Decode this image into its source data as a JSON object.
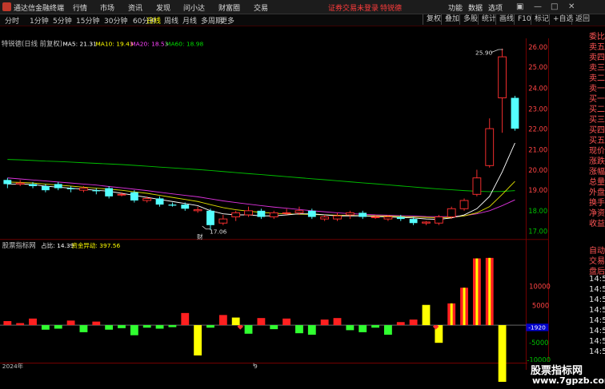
{
  "app": {
    "name": "通达信金融终端"
  },
  "menu": [
    "行情",
    "市场",
    "资讯",
    "发现",
    "问小达",
    "财富圈",
    "交易"
  ],
  "warning": "证券交易未登录",
  "stock_tag": "特锐德",
  "right_menu": [
    "功能",
    "数据",
    "选项"
  ],
  "login": "游客",
  "periods": [
    "分时",
    "1分钟",
    "5分钟",
    "15分钟",
    "30分钟",
    "60分钟",
    "日线",
    "周线",
    "月线",
    "多周期",
    "更多"
  ],
  "active_period": "日线",
  "tool_buttons": [
    "复权",
    "叠加",
    "多股",
    "统计",
    "画线",
    "F10",
    "标记",
    "+自选",
    "返回"
  ],
  "main_title": "特锐德(日线 前复权)",
  "ma": [
    {
      "label": "MA5: 21.31",
      "color": "#ffffff"
    },
    {
      "label": "MA10: 19.43",
      "color": "#ffff00"
    },
    {
      "label": "MA20: 18.53",
      "color": "#ff44ff"
    },
    {
      "label": "MA60: 18.98",
      "color": "#00dd00"
    }
  ],
  "sub_title": "股票指标网",
  "sub_values": [
    {
      "label": "占比: 14.39",
      "color": "#ffffff"
    },
    {
      "label": "资金异动: 397.56",
      "color": "#ffff00"
    }
  ],
  "price_axis": [
    "26.00",
    "25.00",
    "24.00",
    "23.00",
    "22.00",
    "21.00",
    "20.00",
    "19.00",
    "18.00",
    "17.00"
  ],
  "sub_axis": [
    "10000",
    "5000",
    "-5000",
    "-10000"
  ],
  "sub_current": "-1920",
  "annotations": {
    "high": "25.90",
    "low": "17.06",
    "marker": "财"
  },
  "date_labels": [
    "2024年",
    "9"
  ],
  "right_panel": [
    "委比",
    "卖五",
    "卖四",
    "卖三",
    "卖二",
    "卖一",
    "买一",
    "买二",
    "买三",
    "买四",
    "买五",
    "现价",
    "涨跌",
    "涨幅",
    "总量",
    "外盘",
    "换手",
    "净资",
    "收益",
    "自动",
    "交易",
    "盘后",
    "14:5",
    "14:5",
    "14:5",
    "14:5",
    "14:5",
    "14:5",
    "14:5",
    "14:5"
  ],
  "watermark": {
    "line1": "股票指标网",
    "line2": "www.7gpzb.com"
  },
  "chart_data": {
    "type": "candlestick",
    "ylim": [
      16.6,
      26.2
    ],
    "candles": [
      {
        "o": 19.5,
        "c": 19.3,
        "h": 19.6,
        "l": 19.1
      },
      {
        "o": 19.3,
        "c": 19.35,
        "h": 19.5,
        "l": 19.2
      },
      {
        "o": 19.3,
        "c": 19.2,
        "h": 19.4,
        "l": 19.1
      },
      {
        "o": 19.2,
        "c": 19.0,
        "h": 19.3,
        "l": 18.9
      },
      {
        "o": 19.3,
        "c": 19.1,
        "h": 19.4,
        "l": 19.0
      },
      {
        "o": 19.1,
        "c": 19.05,
        "h": 19.2,
        "l": 18.9
      },
      {
        "o": 19.0,
        "c": 19.1,
        "h": 19.2,
        "l": 18.9
      },
      {
        "o": 19.0,
        "c": 18.95,
        "h": 19.1,
        "l": 18.8
      },
      {
        "o": 19.1,
        "c": 18.7,
        "h": 19.2,
        "l": 18.6
      },
      {
        "o": 18.8,
        "c": 18.8,
        "h": 18.9,
        "l": 18.7
      },
      {
        "o": 18.9,
        "c": 18.5,
        "h": 19.0,
        "l": 18.4
      },
      {
        "o": 18.5,
        "c": 18.6,
        "h": 18.7,
        "l": 18.4
      },
      {
        "o": 18.6,
        "c": 18.3,
        "h": 18.7,
        "l": 18.2
      },
      {
        "o": 18.3,
        "c": 18.25,
        "h": 18.4,
        "l": 18.2
      },
      {
        "o": 18.3,
        "c": 18.1,
        "h": 18.4,
        "l": 18.0
      },
      {
        "o": 18.0,
        "c": 18.05,
        "h": 18.2,
        "l": 17.9
      },
      {
        "o": 18.0,
        "c": 17.3,
        "h": 18.1,
        "l": 17.06
      },
      {
        "o": 17.4,
        "c": 17.6,
        "h": 17.8,
        "l": 17.3
      },
      {
        "o": 17.7,
        "c": 17.9,
        "h": 18.0,
        "l": 17.5
      },
      {
        "o": 17.8,
        "c": 18.0,
        "h": 18.2,
        "l": 17.7
      },
      {
        "o": 18.0,
        "c": 17.7,
        "h": 18.1,
        "l": 17.6
      },
      {
        "o": 17.7,
        "c": 17.9,
        "h": 18.0,
        "l": 17.6
      },
      {
        "o": 17.9,
        "c": 17.9,
        "h": 18.1,
        "l": 17.8
      },
      {
        "o": 17.9,
        "c": 18.0,
        "h": 18.2,
        "l": 17.8
      },
      {
        "o": 18.0,
        "c": 17.7,
        "h": 18.1,
        "l": 17.6
      },
      {
        "o": 17.6,
        "c": 17.7,
        "h": 17.8,
        "l": 17.5
      },
      {
        "o": 17.6,
        "c": 17.75,
        "h": 17.9,
        "l": 17.5
      },
      {
        "o": 17.8,
        "c": 17.9,
        "h": 18.0,
        "l": 17.6
      },
      {
        "o": 17.9,
        "c": 17.7,
        "h": 18.0,
        "l": 17.6
      },
      {
        "o": 17.7,
        "c": 17.7,
        "h": 17.8,
        "l": 17.6
      },
      {
        "o": 17.6,
        "c": 17.7,
        "h": 17.8,
        "l": 17.5
      },
      {
        "o": 17.7,
        "c": 17.6,
        "h": 17.8,
        "l": 17.5
      },
      {
        "o": 17.6,
        "c": 17.4,
        "h": 17.7,
        "l": 17.3
      },
      {
        "o": 17.4,
        "c": 17.45,
        "h": 17.5,
        "l": 17.3
      },
      {
        "o": 17.4,
        "c": 17.7,
        "h": 17.8,
        "l": 17.3
      },
      {
        "o": 17.7,
        "c": 18.1,
        "h": 18.2,
        "l": 17.6
      },
      {
        "o": 18.1,
        "c": 18.5,
        "h": 18.6,
        "l": 18.0
      },
      {
        "o": 18.8,
        "c": 19.6,
        "h": 20.0,
        "l": 18.7
      },
      {
        "o": 20.2,
        "c": 22.0,
        "h": 22.5,
        "l": 20.1
      },
      {
        "o": 23.5,
        "c": 25.5,
        "h": 25.9,
        "l": 21.8
      },
      {
        "o": 23.5,
        "c": 22.0,
        "h": 23.6,
        "l": 21.9
      }
    ],
    "ma5": [
      19.3,
      19.3,
      19.28,
      19.2,
      19.15,
      19.1,
      19.05,
      19.0,
      18.95,
      18.85,
      18.75,
      18.65,
      18.55,
      18.45,
      18.35,
      18.25,
      18.0,
      17.85,
      17.8,
      17.8,
      17.75,
      17.75,
      17.8,
      17.85,
      17.85,
      17.8,
      17.75,
      17.75,
      17.75,
      17.72,
      17.7,
      17.68,
      17.65,
      17.6,
      17.58,
      17.65,
      17.8,
      18.1,
      18.7,
      19.9,
      21.3
    ],
    "ma10": [
      19.4,
      19.38,
      19.35,
      19.3,
      19.25,
      19.2,
      19.15,
      19.1,
      19.05,
      19.0,
      18.92,
      18.85,
      18.75,
      18.65,
      18.55,
      18.45,
      18.3,
      18.15,
      18.05,
      17.98,
      17.92,
      17.88,
      17.85,
      17.83,
      17.82,
      17.8,
      17.78,
      17.77,
      17.76,
      17.75,
      17.74,
      17.72,
      17.7,
      17.68,
      17.66,
      17.68,
      17.75,
      17.9,
      18.2,
      18.8,
      19.43
    ],
    "ma20": [
      19.6,
      19.55,
      19.5,
      19.45,
      19.4,
      19.35,
      19.3,
      19.25,
      19.18,
      19.12,
      19.05,
      18.98,
      18.9,
      18.82,
      18.75,
      18.68,
      18.58,
      18.48,
      18.4,
      18.32,
      18.25,
      18.18,
      18.12,
      18.06,
      18.0,
      17.95,
      17.9,
      17.86,
      17.83,
      17.8,
      17.78,
      17.76,
      17.74,
      17.72,
      17.71,
      17.72,
      17.76,
      17.85,
      18.0,
      18.25,
      18.53
    ],
    "ma60": [
      20.5,
      20.48,
      20.45,
      20.42,
      20.4,
      20.37,
      20.34,
      20.31,
      20.28,
      20.25,
      20.21,
      20.17,
      20.13,
      20.09,
      20.05,
      20.01,
      19.96,
      19.91,
      19.86,
      19.81,
      19.76,
      19.71,
      19.66,
      19.61,
      19.56,
      19.51,
      19.46,
      19.41,
      19.36,
      19.31,
      19.26,
      19.21,
      19.16,
      19.11,
      19.06,
      19.02,
      18.98,
      18.95,
      18.93,
      18.94,
      18.98
    ],
    "sub_ylim": [
      -12000,
      14000
    ],
    "sub_bars": [
      {
        "v": 800,
        "c": "red"
      },
      {
        "v": 400,
        "c": "red"
      },
      {
        "v": 1300,
        "c": "red"
      },
      {
        "v": -900,
        "c": "green"
      },
      {
        "v": -700,
        "c": "green"
      },
      {
        "v": 900,
        "c": "red"
      },
      {
        "v": -1400,
        "c": "green"
      },
      {
        "v": 700,
        "c": "red"
      },
      {
        "v": -900,
        "c": "green"
      },
      {
        "v": -600,
        "c": "green"
      },
      {
        "v": -2000,
        "c": "green"
      },
      {
        "v": -500,
        "c": "green"
      },
      {
        "v": -700,
        "c": "green"
      },
      {
        "v": -400,
        "c": "green"
      },
      {
        "v": 2400,
        "c": "red"
      },
      {
        "v": -6000,
        "c": "yellow"
      },
      {
        "v": -500,
        "c": "green"
      },
      {
        "v": 2000,
        "c": "red"
      },
      {
        "v": 1500,
        "c": "yellow"
      },
      {
        "v": -1700,
        "c": "green"
      },
      {
        "v": 1400,
        "c": "red"
      },
      {
        "v": -800,
        "c": "green"
      },
      {
        "v": 1300,
        "c": "red"
      },
      {
        "v": -1600,
        "c": "green"
      },
      {
        "v": -1900,
        "c": "green"
      },
      {
        "v": 1100,
        "c": "red"
      },
      {
        "v": 1400,
        "c": "red"
      },
      {
        "v": -1000,
        "c": "green"
      },
      {
        "v": -1400,
        "c": "green"
      },
      {
        "v": -500,
        "c": "green"
      },
      {
        "v": -1900,
        "c": "green"
      },
      {
        "v": 600,
        "c": "red"
      },
      {
        "v": 1100,
        "c": "red"
      },
      {
        "v": 4000,
        "c": "yellow"
      },
      {
        "v": -3500,
        "c": "yellow"
      },
      {
        "v": 4300,
        "c": "yellow"
      },
      {
        "v": 7400,
        "c": "yellow"
      },
      {
        "v": 13200,
        "c": "yellow"
      },
      {
        "v": 13300,
        "c": "yellow"
      },
      {
        "v": -11500,
        "c": "yellow"
      }
    ]
  }
}
